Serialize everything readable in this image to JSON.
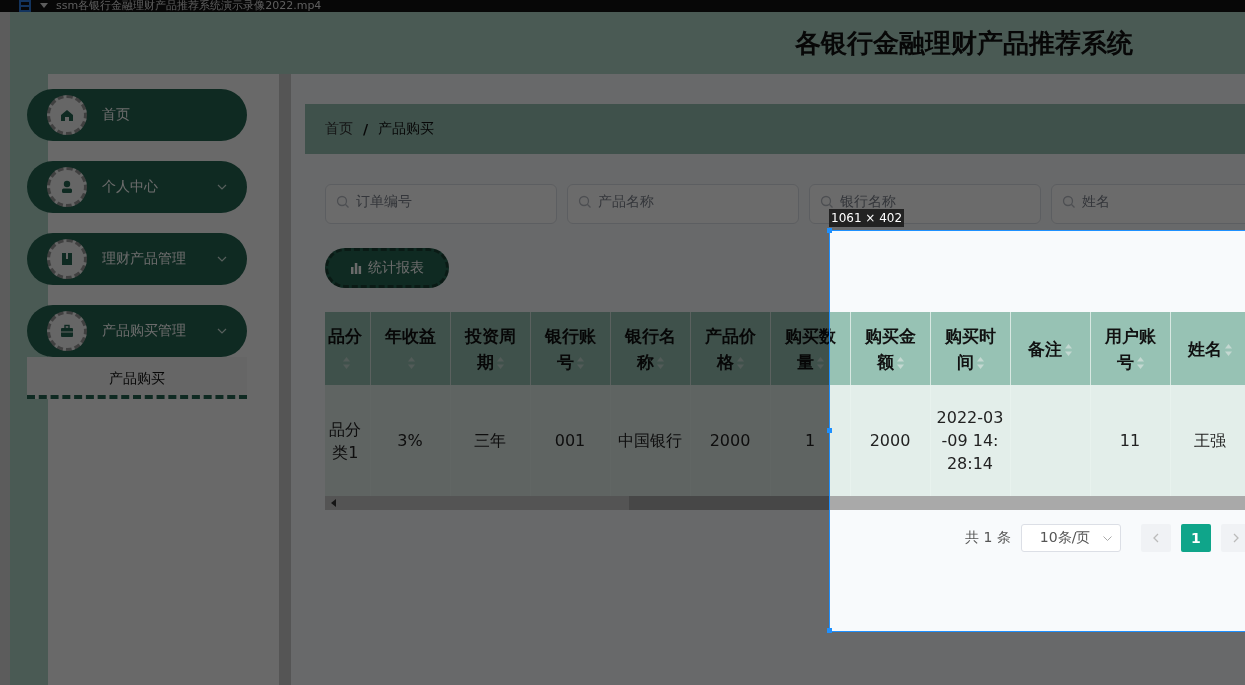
{
  "player": {
    "title": "ssm各银行金融理财产品推荐系统演示录像2022.mp4"
  },
  "header": {
    "title": "各银行金融理财产品推荐系统"
  },
  "sidebar": {
    "items": [
      {
        "label": "首页",
        "kind": "link"
      },
      {
        "label": "个人中心",
        "kind": "submenu"
      },
      {
        "label": "理财产品管理",
        "kind": "submenu"
      },
      {
        "label": "产品购买管理",
        "kind": "submenu",
        "children": [
          {
            "label": "产品购买",
            "selected": true
          }
        ]
      }
    ]
  },
  "breadcrumb": {
    "items": [
      "首页",
      "产品购买"
    ],
    "separator": "/"
  },
  "search": {
    "fields": [
      {
        "placeholder": "订单编号"
      },
      {
        "placeholder": "产品名称"
      },
      {
        "placeholder": "银行名称"
      },
      {
        "placeholder": "姓名"
      }
    ]
  },
  "toolbar": {
    "buttons": [
      "统计报表"
    ]
  },
  "table": {
    "columns": [
      {
        "label": "品分",
        "sortable": true
      },
      {
        "label": "年收益",
        "sortable": true
      },
      {
        "label": "投资周期",
        "sortable": true
      },
      {
        "label": "银行账号",
        "sortable": true
      },
      {
        "label": "银行名称",
        "sortable": true
      },
      {
        "label": "产品价格",
        "sortable": true
      },
      {
        "label": "购买数量",
        "sortable": true
      },
      {
        "label": "购买金额",
        "sortable": true
      },
      {
        "label": "购买时间",
        "sortable": true
      },
      {
        "label": "备注",
        "sortable": true
      },
      {
        "label": "用户账号",
        "sortable": true
      },
      {
        "label": "姓名",
        "sortable": true
      }
    ],
    "rows": [
      {
        "cells": [
          "品分类1",
          "3%",
          "三年",
          "001",
          "中国银行",
          "2000",
          "1",
          "2000",
          "2022-03-09 14:28:14",
          null,
          "11",
          "王强"
        ]
      }
    ]
  },
  "pagination": {
    "total": "共 1 条",
    "page_size": "10条/页",
    "pages": [
      {
        "label": "1",
        "selected": true
      }
    ]
  },
  "capture": {
    "size_label": "1061 × 402"
  }
}
